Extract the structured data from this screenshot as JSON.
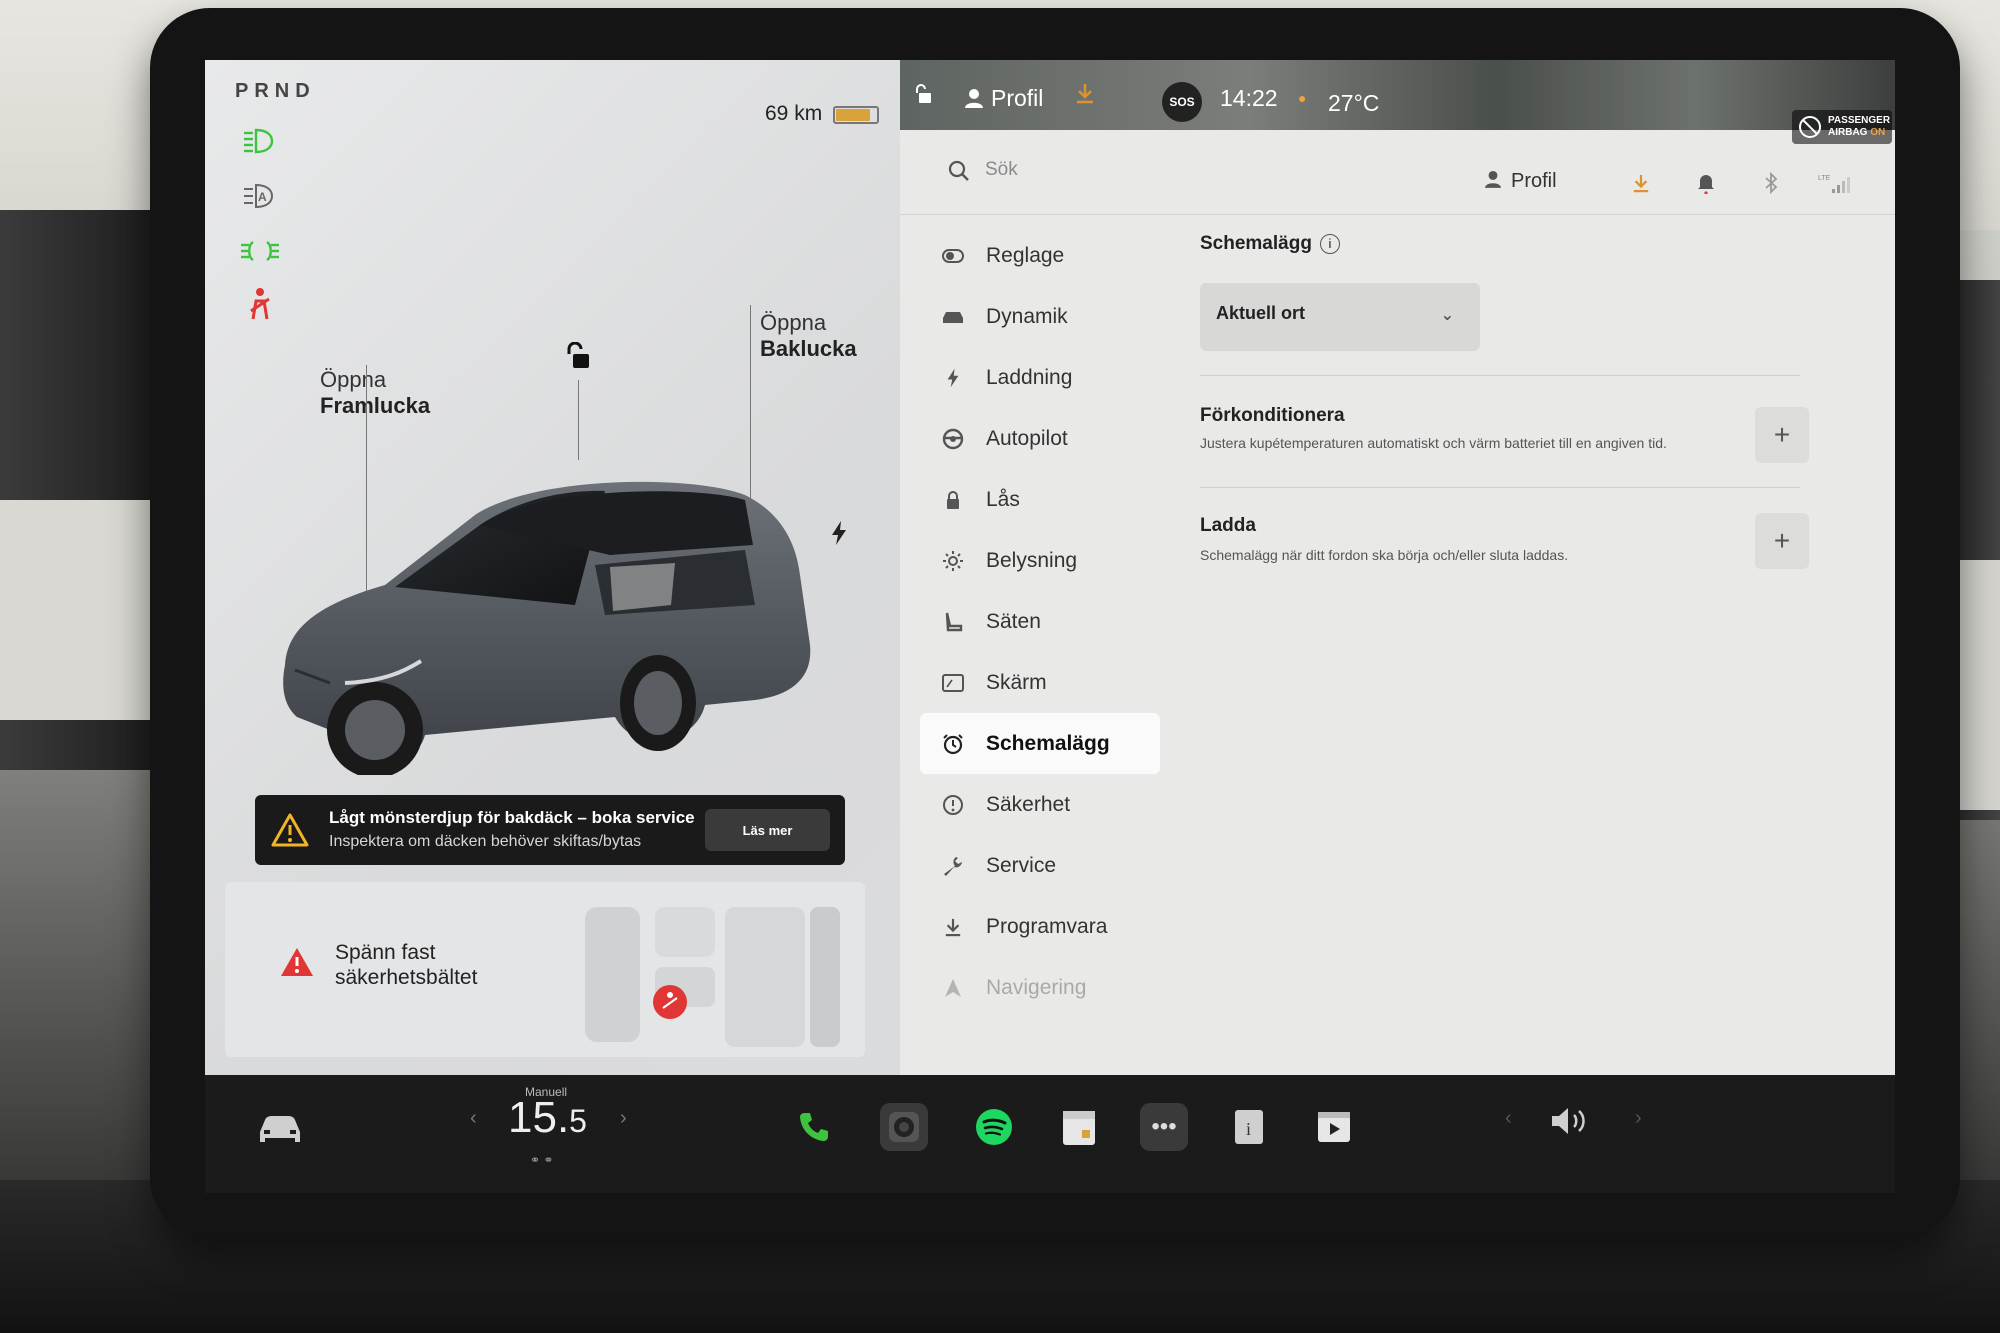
{
  "car": {
    "gears": "PRND",
    "range": "69 km",
    "battery_level": 0.85,
    "front_door": {
      "line1": "Öppna",
      "line2": "Framlucka"
    },
    "trunk": {
      "line1": "Öppna",
      "line2": "Baklucka"
    }
  },
  "alert": {
    "title": "Lågt mönsterdjup för bakdäck – boka service",
    "subtitle": "Inspektera om däcken behöver skiftas/bytas",
    "button": "Läs mer"
  },
  "seatbelt": {
    "line1": "Spänn fast",
    "line2": "säkerhetsbältet"
  },
  "status_bar": {
    "profile": "Profil",
    "sos": "SOS",
    "time": "14:22",
    "temperature": "27°C",
    "airbag_line1": "PASSENGER",
    "airbag_line2_a": "AIRBAG",
    "airbag_line2_b": "ON"
  },
  "header": {
    "search_placeholder": "Sök",
    "profile": "Profil",
    "lte": "LTE"
  },
  "menu": [
    {
      "label": "Reglage",
      "icon": "toggle-icon"
    },
    {
      "label": "Dynamik",
      "icon": "car-icon"
    },
    {
      "label": "Laddning",
      "icon": "bolt-icon"
    },
    {
      "label": "Autopilot",
      "icon": "steering-wheel-icon"
    },
    {
      "label": "Lås",
      "icon": "lock-icon"
    },
    {
      "label": "Belysning",
      "icon": "sun-icon"
    },
    {
      "label": "Säten",
      "icon": "seat-icon"
    },
    {
      "label": "Skärm",
      "icon": "display-icon"
    },
    {
      "label": "Schemalägg",
      "icon": "alarm-clock-icon"
    },
    {
      "label": "Säkerhet",
      "icon": "alert-circle-icon"
    },
    {
      "label": "Service",
      "icon": "wrench-icon"
    },
    {
      "label": "Programvara",
      "icon": "download-icon"
    },
    {
      "label": "Navigering",
      "icon": "navigation-icon"
    }
  ],
  "active_menu": "Schemalägg",
  "schedule": {
    "title": "Schemalägg",
    "location_selected": "Aktuell ort",
    "precondition": {
      "title": "Förkonditionera",
      "description": "Justera kupétemperaturen automatiskt och värm batteriet till en angiven tid."
    },
    "charge": {
      "title": "Ladda",
      "description": "Schemalägg när ditt fordon ska börja och/eller sluta laddas."
    }
  },
  "dock": {
    "climate_mode": "Manuell",
    "climate_temp_int": "15.",
    "climate_temp_dec": "5"
  },
  "colors": {
    "accent_green": "#3ec33e",
    "warning_red": "#e03636",
    "orange": "#e0922f"
  }
}
